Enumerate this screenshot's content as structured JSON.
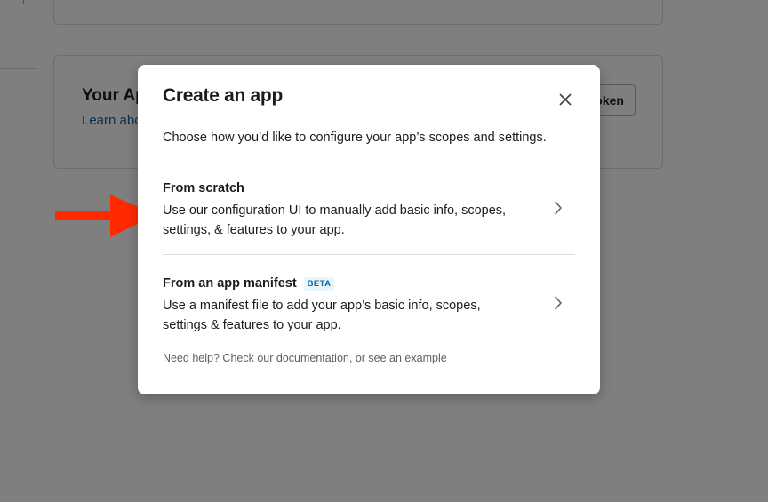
{
  "background": {
    "card_title": "Your Apps",
    "card_link": "Learn about",
    "card_button": "Token"
  },
  "modal": {
    "title": "Create an app",
    "close_icon": "close-icon",
    "subtitle": "Choose how you’d like to configure your app’s scopes and settings.",
    "options": [
      {
        "title": "From scratch",
        "description": "Use our configuration UI to manually add basic info, scopes, settings, & features to your app.",
        "icon": "chevron-right-icon"
      },
      {
        "title": "From an app manifest",
        "badge": "BETA",
        "description": "Use a manifest file to add your app’s basic info, scopes, settings & features to your app.",
        "icon": "chevron-right-icon"
      }
    ],
    "help": {
      "prefix": "Need help? Check our ",
      "link1": "documentation",
      "middle": ", or ",
      "link2": "see an example"
    }
  },
  "annotation": {
    "icon": "arrow-right-icon",
    "color": "#ff2a00"
  },
  "colors": {
    "link": "#1264a3",
    "overlay": "rgba(0,0,0,0.5)"
  }
}
